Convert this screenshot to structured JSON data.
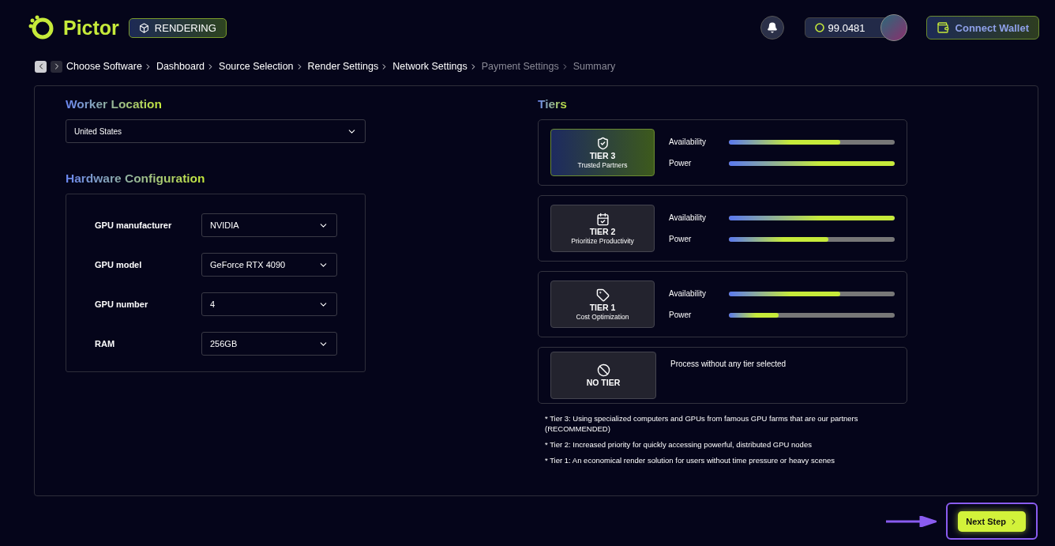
{
  "header": {
    "brand": "Pictor",
    "mode_badge": "RENDERING",
    "balance": "99.0481",
    "connect_button": "Connect Wallet"
  },
  "breadcrumb": [
    {
      "label": "Choose Software",
      "done": true
    },
    {
      "label": "Dashboard",
      "done": true
    },
    {
      "label": "Source Selection",
      "done": true
    },
    {
      "label": "Render Settings",
      "done": true
    },
    {
      "label": "Network Settings",
      "done": true
    },
    {
      "label": "Payment Settings",
      "done": false
    },
    {
      "label": "Summary",
      "done": false
    }
  ],
  "worker_location": {
    "title": "Worker Location",
    "value": "United States"
  },
  "hardware": {
    "title": "Hardware Configuration",
    "fields": [
      {
        "label": "GPU manufacturer",
        "value": "NVIDIA"
      },
      {
        "label": "GPU model",
        "value": "GeForce RTX 4090"
      },
      {
        "label": "GPU number",
        "value": "4"
      },
      {
        "label": "RAM",
        "value": "256GB"
      }
    ]
  },
  "tiers": {
    "title": "Tiers",
    "items": [
      {
        "kind": "tier",
        "name": "TIER 3",
        "subtitle": "Trusted Partners",
        "selected": true,
        "metrics": [
          {
            "label": "Availability",
            "level": 0.67
          },
          {
            "label": "Power",
            "level": 1
          }
        ]
      },
      {
        "kind": "tier",
        "name": "TIER 2",
        "subtitle": "Prioritize Productivity",
        "selected": false,
        "metrics": [
          {
            "label": "Availability",
            "level": 1
          },
          {
            "label": "Power",
            "level": 0.6
          }
        ]
      },
      {
        "kind": "tier",
        "name": "TIER 1",
        "subtitle": "Cost Optimization",
        "selected": false,
        "metrics": [
          {
            "label": "Availability",
            "level": 0.67
          },
          {
            "label": "Power",
            "level": 0.3
          }
        ]
      },
      {
        "kind": "none",
        "name": "NO TIER",
        "description": "Process without any tier selected",
        "selected": false
      }
    ],
    "notes": [
      "* Tier 3: Using specialized computers and GPUs from famous GPU farms that are our partners (RECOMMENDED)",
      "* Tier 2: Increased priority for quickly accessing powerful, distributed GPU nodes",
      "* Tier 1: An economical render solution for users without time pressure or heavy scenes"
    ]
  },
  "next_button": "Next Step"
}
